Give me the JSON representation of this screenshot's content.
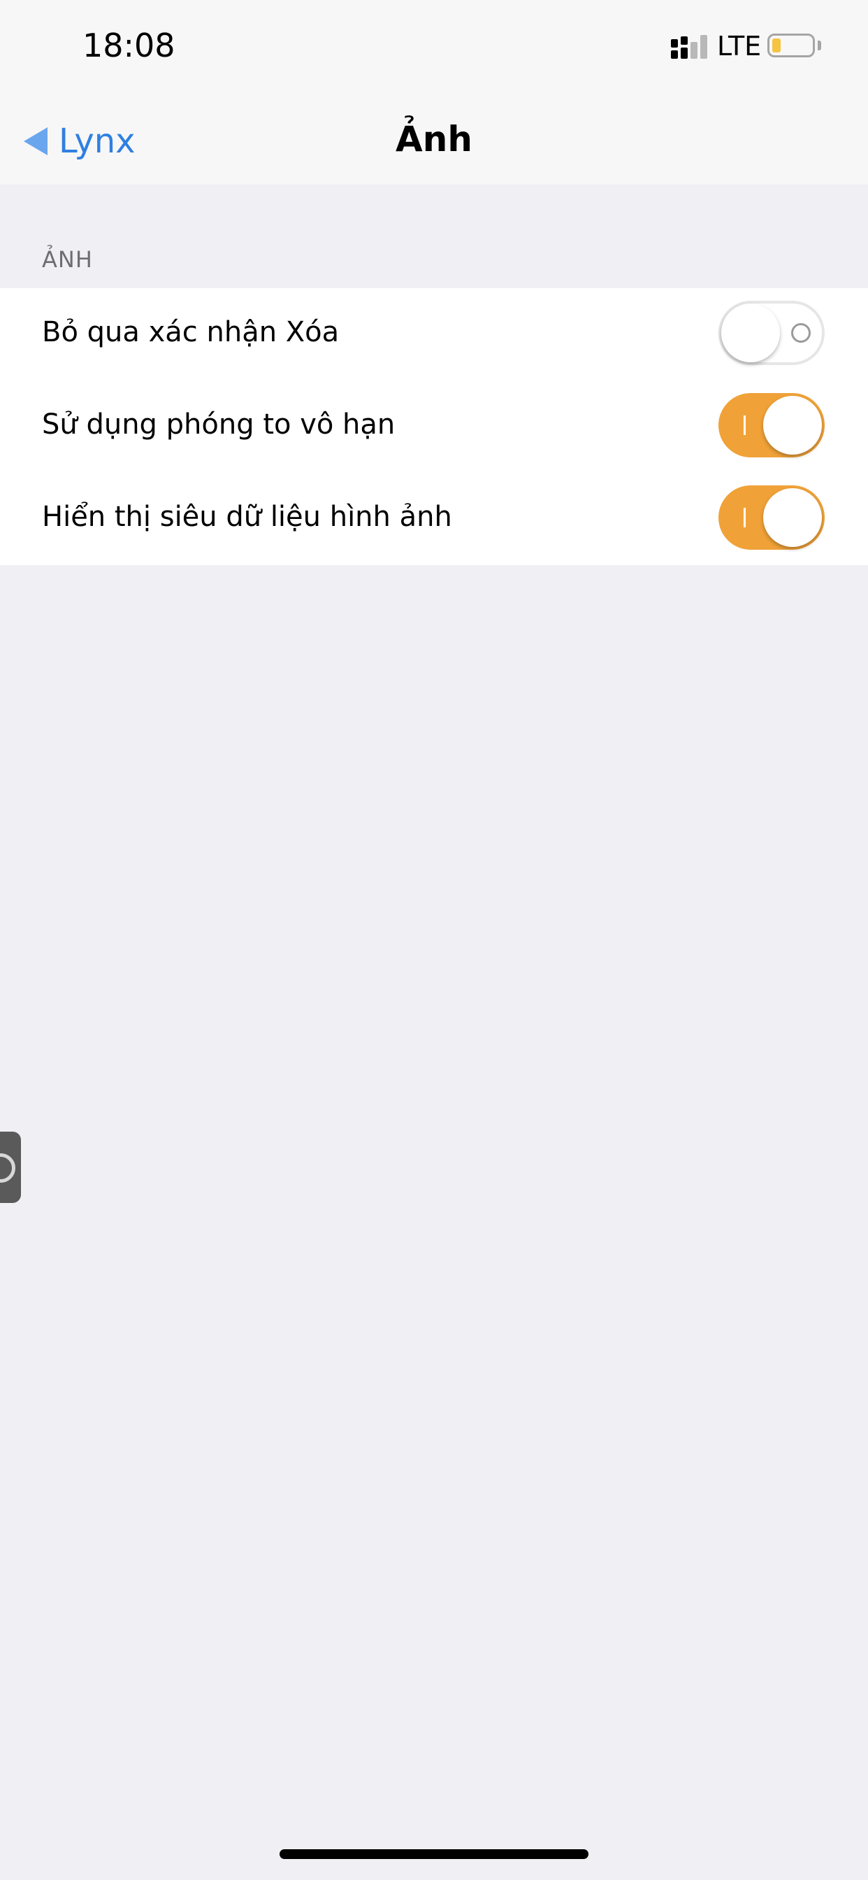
{
  "status_bar": {
    "time": "18:08",
    "network": "LTE",
    "icons": [
      "signal-icon",
      "battery-icon"
    ]
  },
  "nav": {
    "back_label": "Lynx",
    "title": "Ảnh"
  },
  "section": {
    "header": "ẢNH",
    "rows": [
      {
        "label": "Bỏ qua xác nhận Xóa",
        "enabled": false
      },
      {
        "label": "Sử dụng phóng to vô hạn",
        "enabled": true
      },
      {
        "label": "Hiển thị siêu dữ liệu hình ảnh",
        "enabled": true
      }
    ]
  },
  "colors": {
    "accent_blue": "#2f7fe0",
    "toggle_on": "#f0a238",
    "background": "#efeff4",
    "battery_fill": "#f6c443"
  }
}
